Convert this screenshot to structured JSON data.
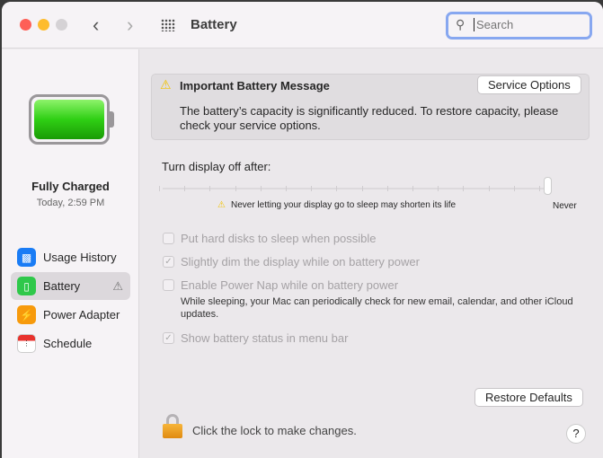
{
  "window": {
    "title": "Battery"
  },
  "search": {
    "placeholder": "Search",
    "value": ""
  },
  "battery": {
    "status": "Fully Charged",
    "time": "Today, 2:59 PM",
    "level_percent": 100
  },
  "sidebar": {
    "items": [
      {
        "label": "Usage History",
        "icon": "chart-bars-icon",
        "color": "#1a7cf5"
      },
      {
        "label": "Battery",
        "icon": "battery-icon",
        "color": "#2fc84a",
        "selected": true,
        "warning": true
      },
      {
        "label": "Power Adapter",
        "icon": "lightning-icon",
        "color": "#f79a0c"
      },
      {
        "label": "Schedule",
        "icon": "calendar-icon",
        "color": "#e6e3e6"
      }
    ]
  },
  "alert": {
    "title": "Important Battery Message",
    "body": "The battery’s capacity is significantly reduced. To restore capacity, please check your service options.",
    "button": "Service Options"
  },
  "slider": {
    "label": "Turn display off after:",
    "value": "Never",
    "warning": "Never letting your display go to sleep may shorten its life",
    "end_label": "Never"
  },
  "options": [
    {
      "label": "Put hard disks to sleep when possible",
      "checked": false
    },
    {
      "label": "Slightly dim the display while on battery power",
      "checked": true
    },
    {
      "label": "Enable Power Nap while on battery power",
      "checked": false,
      "description": "While sleeping, your Mac can periodically check for new email, calendar, and other iCloud updates."
    },
    {
      "label": "Show battery status in menu bar",
      "checked": true
    }
  ],
  "footer": {
    "restore": "Restore Defaults",
    "lock_text": "Click the lock to make changes.",
    "help": "?"
  }
}
